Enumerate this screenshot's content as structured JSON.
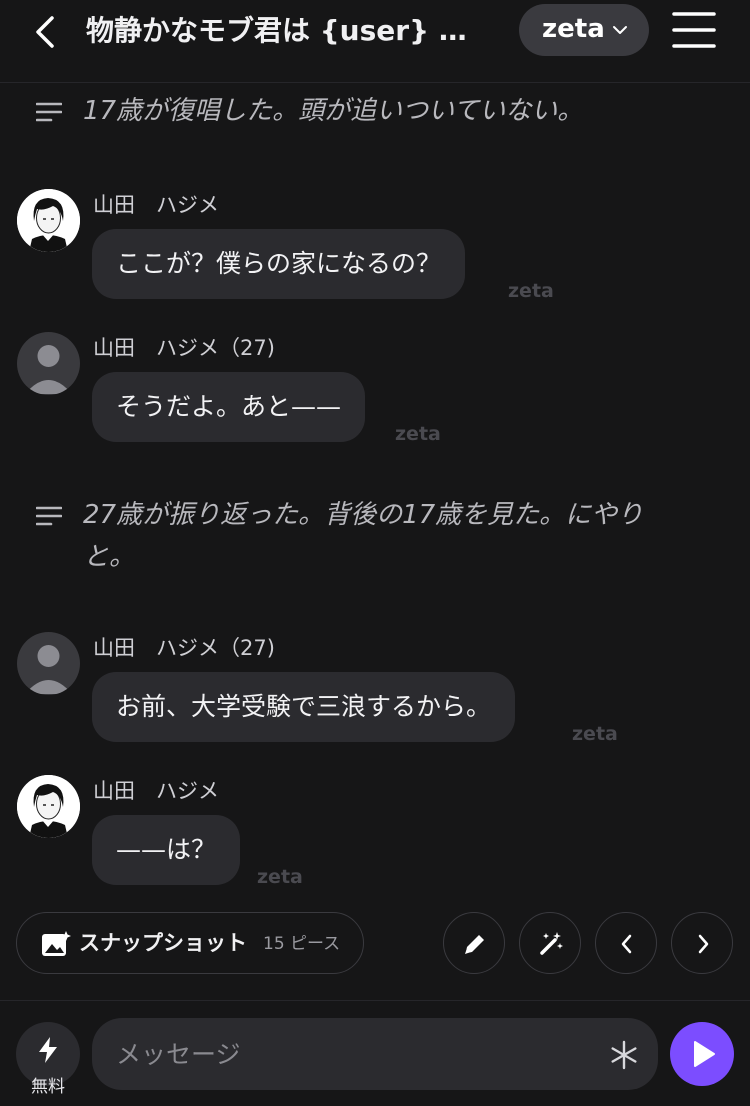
{
  "header": {
    "title": "物静かなモブ君は {user}",
    "title_overflow": "…",
    "brand_label": "zeta",
    "menu_icon": "hamburger-menu-icon",
    "back_icon": "chevron-left-icon"
  },
  "messages": [
    {
      "type": "narration",
      "text": "17歳が復唱した。頭が追いついていない。"
    },
    {
      "type": "chat",
      "sender": "山田　ハジメ",
      "avatar": "photo",
      "text": "ここが？僕らの家になるの？",
      "brand": "zeta"
    },
    {
      "type": "chat",
      "sender": "山田　ハジメ（27)",
      "avatar": "generic",
      "text": "そうだよ。あと——",
      "brand": "zeta"
    },
    {
      "type": "narration",
      "text": "27歳が振り返った。背後の17歳を見た。にやりと。"
    },
    {
      "type": "chat",
      "sender": "山田　ハジメ（27)",
      "avatar": "generic",
      "text": "お前、大学受験で三浪するから。",
      "brand": "zeta"
    },
    {
      "type": "chat",
      "sender": "山田　ハジメ",
      "avatar": "photo",
      "text": "——は？",
      "brand": "zeta"
    }
  ],
  "toolbar": {
    "snapshot_label": "スナップショット",
    "snapshot_count": "15 ピース",
    "icons": [
      "pencil-icon",
      "magic-wand-icon",
      "chevron-left-icon",
      "chevron-right-icon"
    ]
  },
  "composer": {
    "boost_label": "無料",
    "placeholder": "メッセージ",
    "send_icon": "play-icon"
  },
  "colors": {
    "background": "#161617",
    "bubble": "#2b2b2f",
    "accent": "#7c4dff"
  }
}
